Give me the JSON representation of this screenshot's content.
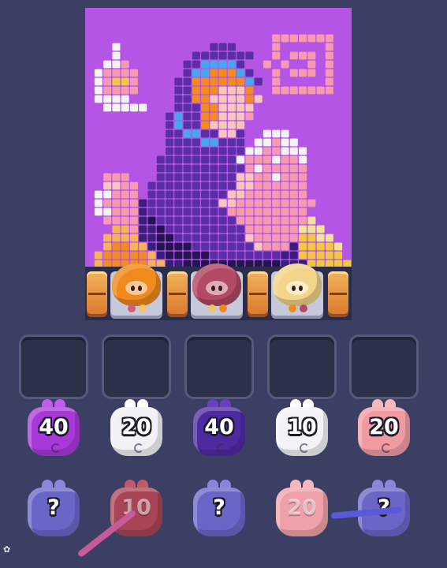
{
  "board": {
    "palette": {
      "a": "#b455e6",
      "b": "#8f3fd6",
      "p": "#5a2ea6",
      "d": "#3a1f7a",
      "n": "#241552",
      "l": "#46a6f2",
      "o": "#f58a1f",
      "g": "#f7b25a",
      "s": "#f7c6bd",
      "k": "#f59ab0",
      "w": "#f3f3f3",
      "c": "#f3e39a",
      "y": "#f2c640",
      "r": "#e05a2a"
    },
    "rows": [
      "aaaaaaaaaaaaaaaaaaaaaaaaaaaaaa",
      "aaaaaaaaaaaaaaaaaaaaaaaaaaaaaa",
      "aaaaaaaaaaaaaaaaaaaaaaaaaaaaaa",
      "aaaaaaaaaaaaaaaaaaaaakkkkkkkaa",
      "aaawaaaaaaaaaapppaaaakaaaaakaa",
      "aaawaaaaaaaapppppppaakakkkakaa",
      "aawwkaaaaaappllllpaakakaakakaa",
      "awkkkkaaaaapllooolpaakakkkakaa",
      "awkyykaaaappoooooolpakaaaaakaa",
      "awkkkkaaaappooosssoaakkkkkkkaa",
      "awwwwaaaaappoossssosaaaaaaaaaa",
      "aawwwwwaaapppoossssaaaaaaaaaaa",
      "aaaaaaaaaplppoossskaaaaaaaaaaa",
      "aaaaaaaaaplppossssaaaaaaaaaaaa",
      "aaaaaaaaappllppsspaawwwaaaaaaa",
      "aaaaaaaaappppllpppawwkwwaaaaaa",
      "aaaaaaaaapppppppppwwkkwwwaaaaa",
      "aaaaaaaapppppppppwkkkwkkwaaaaa",
      "aaaaaaaappppppppppkwkkkkkaaaaa",
      "aakkkaaapppppppppsskkwkkkaaaaa",
      "aasskkappppppppppsskkkkkkaaaaa",
      "awwkkkapppppppppsskkkkkkkaaaaa",
      "awkkkkdppppppppsskkkkkkkkkaaaa",
      "awwkkkdpppppppppkkkkkkkkkaaaaa",
      "aakkkkdnpppppppppkkkkkkkkcaaaa",
      "aaaggkddnpppppppppkkkkkkcccaaa",
      "aaggggddnnppppppppskkkkkyyccaa",
      "aagooggdnnnnpppppppskkkdyyyyca",
      "agooooogdnnnnnppppppppddyyyyya",
      "agoooooggddnnnnnnnnnnndddyyyyy"
    ]
  },
  "shelf": {
    "pigs": [
      {
        "color": "#f08a1e",
        "feet": [
          "#d25a7a",
          "#f5c36a"
        ]
      },
      {
        "color": "#b24a63",
        "feet": [
          "#f5c36a",
          "#f08a1e"
        ]
      },
      {
        "color": "#f2d48a",
        "feet": [
          "#f08a1e",
          "#b24a63"
        ]
      }
    ]
  },
  "front_row": [
    {
      "label": "40",
      "color": "#a838d8",
      "ear": "#c25aee"
    },
    {
      "label": "20",
      "color": "#f1f1f6",
      "ear": "#ffffff"
    },
    {
      "label": "40",
      "color": "#4e2aa0",
      "ear": "#6a3fc4"
    },
    {
      "label": "10",
      "color": "#f3f3f7",
      "ear": "#ffffff"
    },
    {
      "label": "20",
      "color": "#f09aa2",
      "ear": "#f7b7bd"
    }
  ],
  "back_row": [
    {
      "label": "?",
      "color": "#6a66c8",
      "ear": "#8a86dc",
      "faded": false
    },
    {
      "label": "10",
      "color": "#a84555",
      "ear": "#c25a6a",
      "faded": true
    },
    {
      "label": "?",
      "color": "#6a66c8",
      "ear": "#8a86dc",
      "faded": false
    },
    {
      "label": "20",
      "color": "#f0a0a8",
      "ear": "#f7b7bd",
      "faded": true
    },
    {
      "label": "?",
      "color": "#6a66c8",
      "ear": "#8a86dc",
      "faded": false
    }
  ]
}
